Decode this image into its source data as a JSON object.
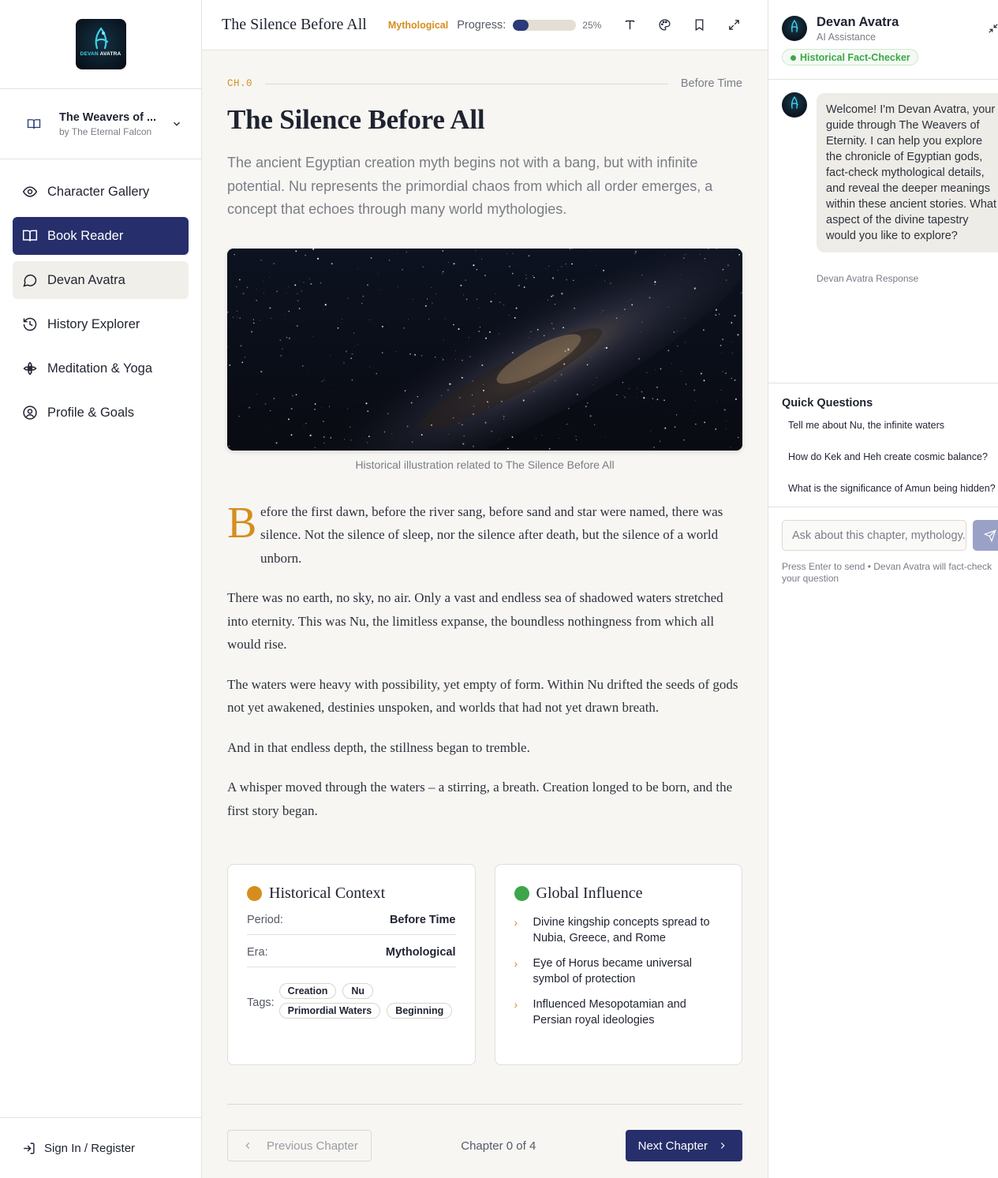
{
  "logo": {
    "brand_a": "DEVAN",
    "brand_b": "AVATRA"
  },
  "book": {
    "title": "The Weavers of ...",
    "author": "by The Eternal Falcon"
  },
  "nav": [
    {
      "label": "Character Gallery",
      "icon": "eye-icon"
    },
    {
      "label": "Book Reader",
      "icon": "book-open-icon",
      "active": true
    },
    {
      "label": "Devan Avatra",
      "icon": "chat-bubble-icon"
    },
    {
      "label": "History Explorer",
      "icon": "history-icon"
    },
    {
      "label": "Meditation & Yoga",
      "icon": "lotus-icon"
    },
    {
      "label": "Profile & Goals",
      "icon": "user-circle-icon"
    }
  ],
  "signin": {
    "label": "Sign In / Register"
  },
  "topbar": {
    "title": "The Silence Before All",
    "tag": "Mythological",
    "progress_label": "Progress:",
    "progress_value": 0.25,
    "progress_text": "25%"
  },
  "chapter": {
    "number": "CH.0",
    "when": "Before Time",
    "title": "The Silence Before All",
    "lede": "The ancient Egyptian creation myth begins not with a bang, but with infinite potential. Nu represents the primordial chaos from which all order emerges, a concept that echoes through many world mythologies.",
    "caption": "Historical illustration related to The Silence Before All",
    "dropcap": "B",
    "p1": "efore the first dawn, before the river sang, before sand and star were named, there was silence. Not the silence of sleep, nor the silence after death, but the silence of a world unborn.",
    "p2": "There was no earth, no sky, no air. Only a vast and endless sea of shadowed waters stretched into eternity. This was Nu, the limitless expanse, the boundless nothingness from which all would rise.",
    "p3": "The waters were heavy with possibility, yet empty of form. Within Nu drifted the seeds of gods not yet awakened, destinies unspoken, and worlds that had not yet drawn breath.",
    "p4": "And in that endless depth, the stillness began to tremble.",
    "p5": "A whisper moved through the waters – a stirring, a breath. Creation longed to be born, and the first story began."
  },
  "context": {
    "title": "Historical Context",
    "period_label": "Period:",
    "period": "Before Time",
    "era_label": "Era:",
    "era": "Mythological",
    "tags_label": "Tags:",
    "tags": [
      "Creation",
      "Nu",
      "Primordial Waters",
      "Beginning"
    ],
    "dot_color": "#d58e1e"
  },
  "influence": {
    "title": "Global Influence",
    "items": [
      "Divine kingship concepts spread to Nubia, Greece, and Rome",
      "Eye of Horus became universal symbol of protection",
      "Influenced Mesopotamian and Persian royal ideologies"
    ],
    "dot_color": "#3da64a"
  },
  "pager": {
    "prev": "Previous Chapter",
    "count": "Chapter 0 of 4",
    "next": "Next Chapter"
  },
  "assistant": {
    "name": "Devan Avatra",
    "sub": "AI Assistance",
    "badge": "Historical Fact-Checker",
    "message": "Welcome! I'm Devan Avatra, your guide through The Weavers of Eternity. I can help you explore the chronicle of Egyptian gods, fact-check mythological details, and reveal the deeper meanings within these ancient stories. What aspect of the divine tapestry would you like to explore?",
    "message_meta": "Devan Avatra Response",
    "quick_title": "Quick Questions",
    "quick": [
      "Tell me about Nu, the infinite waters",
      "How do Kek and Heh create cosmic balance?",
      "What is the significance of Amun being hidden?"
    ],
    "input_placeholder": "Ask about this chapter, mythology...",
    "hint": "Press Enter to send • Devan Avatra will fact-check your question"
  }
}
